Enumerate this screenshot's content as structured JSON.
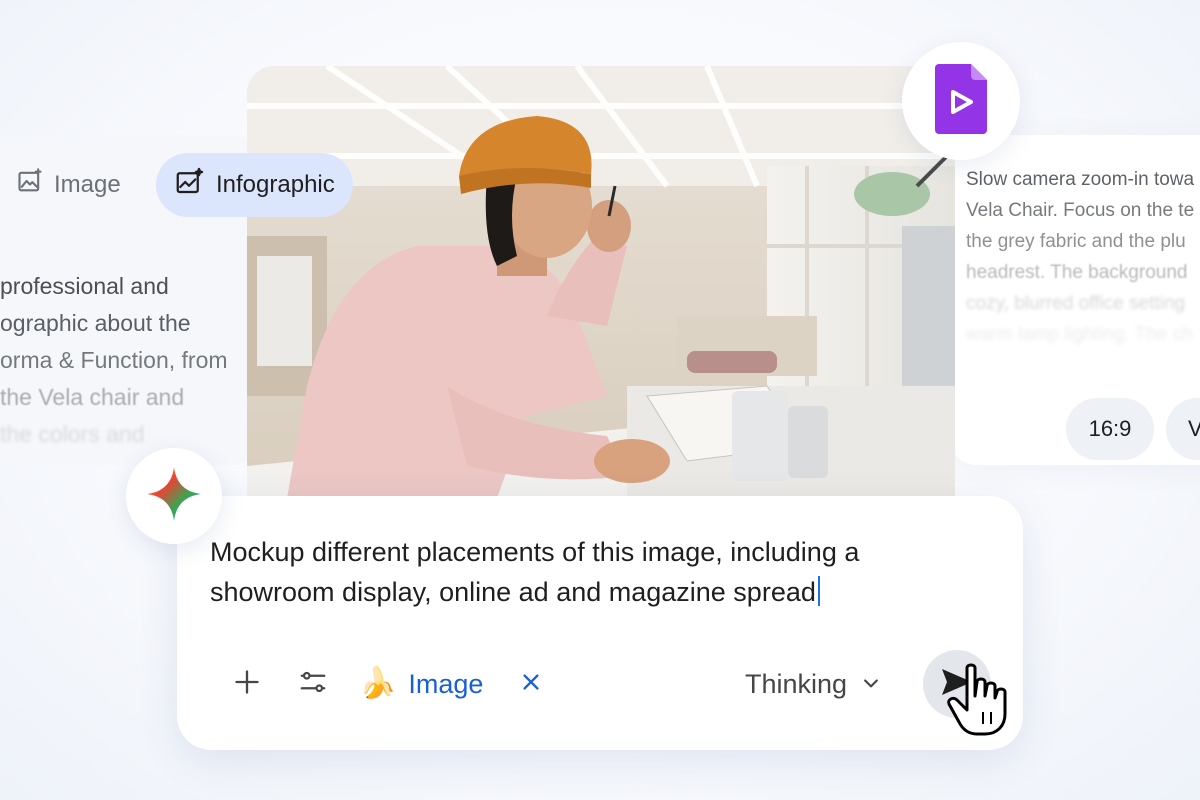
{
  "left_panel": {
    "chips": [
      {
        "label": "Image",
        "icon": "image-icon"
      }
    ],
    "active_chip": {
      "label": "Infographic",
      "icon": "infographic-icon"
    },
    "text_lines": [
      "professional and",
      "ographic about the",
      "orma & Function, from",
      "the Vela chair and",
      "the colors and"
    ]
  },
  "right_panel": {
    "text_lines": [
      "Slow camera zoom-in towa",
      "Vela Chair. Focus on the te",
      "the grey fabric and the plu",
      "headrest. The background",
      "cozy, blurred office setting",
      "warm lamp lighting. The ch"
    ],
    "pills": [
      "16:9",
      "V"
    ],
    "doc_icon": "video-file-icon",
    "doc_color": "#9334e6"
  },
  "photo": {
    "alt": "photo-of-person-at-desk"
  },
  "prompt": {
    "text": "Mockup different placements of this image, including a showroom display, online ad and magazine spread",
    "toolbar": {
      "add_icon": "plus-icon",
      "tools_icon": "tune-icon",
      "tool_chip": {
        "emoji": "🍌",
        "label": "Image"
      },
      "remove_icon": "close-icon",
      "mode": {
        "label": "Thinking",
        "icon": "chevron-down-icon"
      },
      "send_icon": "send-icon"
    }
  },
  "colors": {
    "accent_blue": "#1a5fd6",
    "chip_active_bg": "#dbe5fb",
    "card_bg": "#ffffff",
    "caret": "#1a73e8"
  }
}
